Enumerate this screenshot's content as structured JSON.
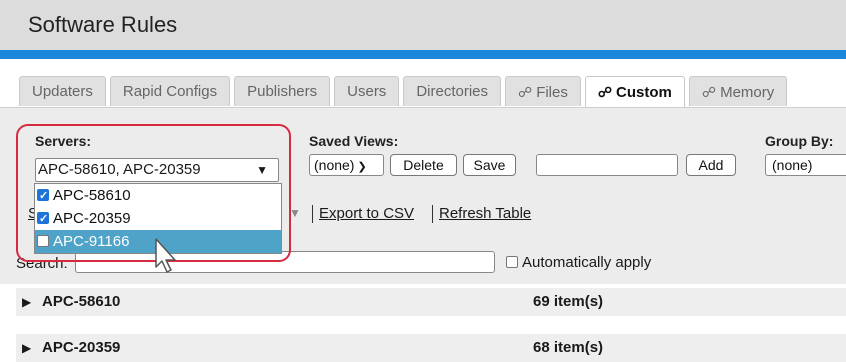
{
  "window": {
    "title": "Software Rules"
  },
  "tabs": [
    {
      "label": "Updaters",
      "icon": ""
    },
    {
      "label": "Rapid Configs",
      "icon": ""
    },
    {
      "label": "Publishers",
      "icon": ""
    },
    {
      "label": "Users",
      "icon": ""
    },
    {
      "label": "Directories",
      "icon": ""
    },
    {
      "label": "Files",
      "icon": "files-icon"
    },
    {
      "label": "Custom",
      "icon": "custom-icon",
      "active": true
    },
    {
      "label": "Memory",
      "icon": "memory-icon"
    }
  ],
  "servers": {
    "label": "Servers:",
    "selected_value": "APC-58610, APC-20359",
    "options": [
      {
        "label": "APC-58610",
        "checked": true
      },
      {
        "label": "APC-20359",
        "checked": true
      },
      {
        "label": "APC-91166",
        "checked": false,
        "highlighted": true
      }
    ]
  },
  "saved_views": {
    "label": "Saved Views:",
    "select_value": "(none)",
    "delete_label": "Delete",
    "save_label": "Save",
    "name_value": "",
    "add_label": "Add"
  },
  "group_by": {
    "label": "Group By:",
    "value": "(none)"
  },
  "actions": {
    "export_label": "Export to CSV",
    "refresh_label": "Refresh Table"
  },
  "search": {
    "label": "Search:",
    "value": "",
    "auto_apply_label": "Automatically apply",
    "auto_apply_checked": false
  },
  "groups": [
    {
      "name": "APC-58610",
      "count": "69 item(s)"
    },
    {
      "name": "APC-20359",
      "count": "68 item(s)"
    }
  ],
  "colors": {
    "accent": "#1b87d8",
    "highlight": "#4fa3c8",
    "annotation": "#d62b3f"
  }
}
